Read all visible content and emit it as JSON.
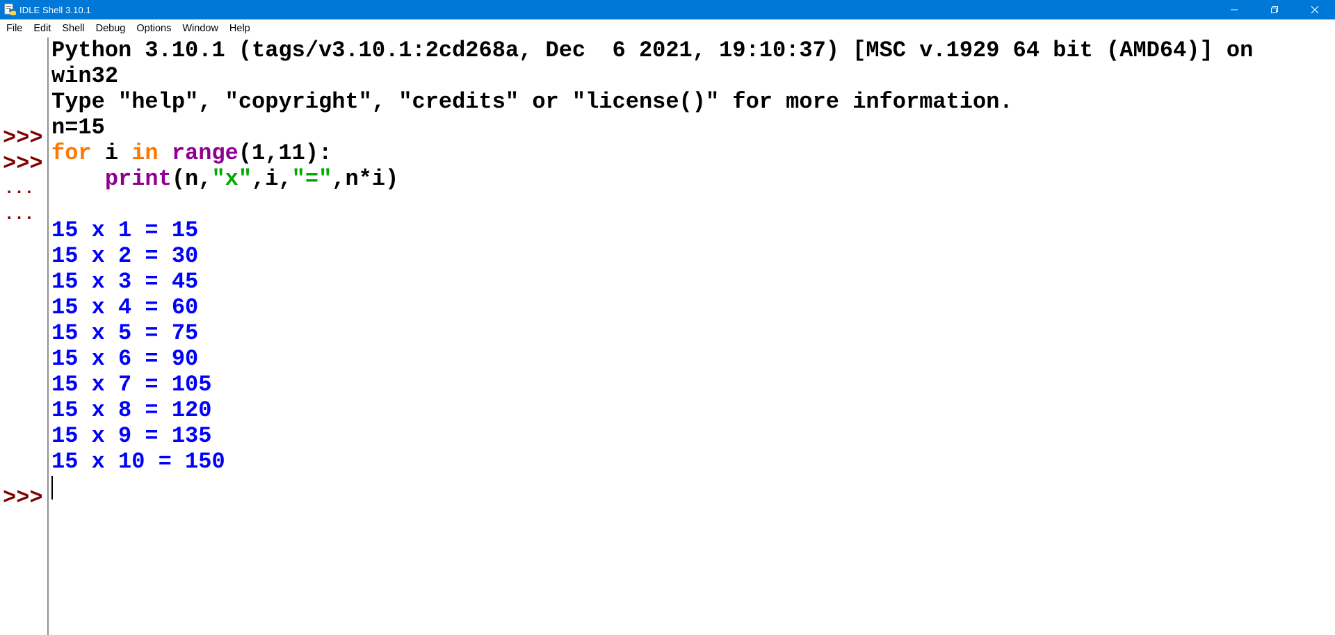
{
  "window": {
    "title": "IDLE Shell 3.10.1",
    "titlebar_color": "#0078d7"
  },
  "menu": {
    "items": [
      "File",
      "Edit",
      "Shell",
      "Debug",
      "Options",
      "Window",
      "Help"
    ]
  },
  "icons": {
    "app": "python-idle-icon",
    "minimize": "minimize-icon",
    "restore": "restore-icon",
    "close": "close-icon"
  },
  "colors": {
    "prompt": "#7f0000",
    "keyword": "#ff7700",
    "builtin": "#900090",
    "string": "#00aa00",
    "output": "#0000ff",
    "text": "#000000"
  },
  "shell": {
    "banner_line1": "Python 3.10.1 (tags/v3.10.1:2cd268a, Dec  6 2021, 19:10:37) [MSC v.1929 64 bit (AMD64)] on",
    "banner_line2": "win32",
    "banner_line3": "Type \"help\", \"copyright\", \"credits\" or \"license()\" for more information.",
    "prompt_symbol": ">>>",
    "continuation_symbol": "...",
    "input1": "n=15",
    "input2": {
      "kw_for": "for",
      "var_i": " i ",
      "kw_in": "in",
      "sp": " ",
      "fn_range": "range",
      "args": "(1,11):"
    },
    "input3": {
      "indent": "    ",
      "fn_print": "print",
      "p1": "(n,",
      "s1": "\"x\"",
      "p2": ",i,",
      "s2": "\"=\"",
      "p3": ",n*i)"
    },
    "output": [
      "15 x 1 = 15",
      "15 x 2 = 30",
      "15 x 3 = 45",
      "15 x 4 = 60",
      "15 x 5 = 75",
      "15 x 6 = 90",
      "15 x 7 = 105",
      "15 x 8 = 120",
      "15 x 9 = 135",
      "15 x 10 = 150"
    ]
  }
}
